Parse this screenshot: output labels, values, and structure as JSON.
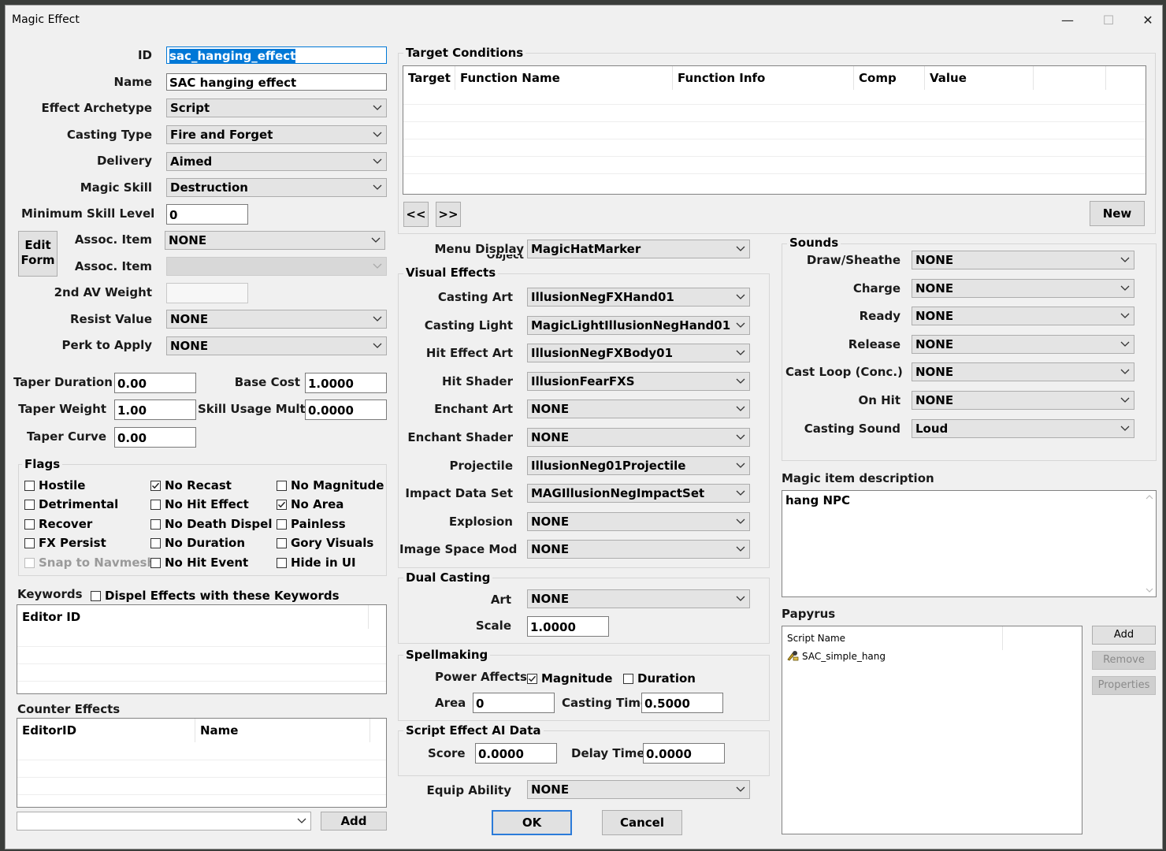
{
  "window": {
    "title": "Magic Effect",
    "minimize": "—",
    "maximize": "☐",
    "close": "✕"
  },
  "left": {
    "id_label": "ID",
    "id_value": "sac_hanging_effect",
    "name_label": "Name",
    "name_value": "SAC hanging effect",
    "archetype_label": "Effect Archetype",
    "archetype_value": "Script",
    "casting_type_label": "Casting Type",
    "casting_type_value": "Fire and Forget",
    "delivery_label": "Delivery",
    "delivery_value": "Aimed",
    "magic_skill_label": "Magic Skill",
    "magic_skill_value": "Destruction",
    "min_skill_label": "Minimum Skill Level",
    "min_skill_value": "0",
    "edit_form_label": "Edit Form",
    "assoc_item_label": "Assoc. Item",
    "assoc_item_value": "NONE",
    "assoc_item2_label": "Assoc. Item",
    "second_av_label": "2nd AV Weight",
    "second_av_value": "",
    "resist_label": "Resist Value",
    "resist_value": "NONE",
    "perk_label": "Perk to Apply",
    "perk_value": "NONE",
    "taper_duration_label": "Taper Duration",
    "taper_duration_value": "0.00",
    "base_cost_label": "Base Cost",
    "base_cost_value": "1.0000",
    "taper_weight_label": "Taper Weight",
    "taper_weight_value": "1.00",
    "skill_usage_label": "Skill Usage Mult",
    "skill_usage_value": "0.0000",
    "taper_curve_label": "Taper Curve",
    "taper_curve_value": "0.00"
  },
  "flags": {
    "label": "Flags",
    "items": [
      {
        "label": "Hostile",
        "checked": false,
        "disabled": false
      },
      {
        "label": "No Recast",
        "checked": true,
        "disabled": false
      },
      {
        "label": "No Magnitude",
        "checked": false,
        "disabled": false
      },
      {
        "label": "Detrimental",
        "checked": false,
        "disabled": false
      },
      {
        "label": "No Hit Effect",
        "checked": false,
        "disabled": false
      },
      {
        "label": "No Area",
        "checked": true,
        "disabled": false
      },
      {
        "label": "Recover",
        "checked": false,
        "disabled": false
      },
      {
        "label": "No Death Dispel",
        "checked": false,
        "disabled": false
      },
      {
        "label": "Painless",
        "checked": false,
        "disabled": false
      },
      {
        "label": "FX Persist",
        "checked": false,
        "disabled": false
      },
      {
        "label": "No Duration",
        "checked": false,
        "disabled": false
      },
      {
        "label": "Gory Visuals",
        "checked": false,
        "disabled": false
      },
      {
        "label": "Snap to Navmesh",
        "checked": false,
        "disabled": true
      },
      {
        "label": "No Hit Event",
        "checked": false,
        "disabled": false
      },
      {
        "label": "Hide in UI",
        "checked": false,
        "disabled": false
      }
    ]
  },
  "keywords": {
    "label": "Keywords",
    "dispel_label": "Dispel Effects with these Keywords",
    "column": "Editor ID"
  },
  "counter": {
    "label": "Counter Effects",
    "col1": "EditorID",
    "col2": "Name",
    "add_label": "Add",
    "combo_value": ""
  },
  "target": {
    "label": "Target Conditions",
    "columns": [
      "Target",
      "Function Name",
      "Function Info",
      "Comp",
      "Value",
      ""
    ],
    "prev": "<<",
    "next": ">>",
    "new_label": "New"
  },
  "menu_display": {
    "label": "Menu Display",
    "sublabel": "Object",
    "value": "MagicHatMarker"
  },
  "visual": {
    "label": "Visual Effects",
    "rows": [
      {
        "label": "Casting Art",
        "value": "IllusionNegFXHand01"
      },
      {
        "label": "Casting Light",
        "value": "MagicLightIllusionNegHand01"
      },
      {
        "label": "Hit Effect Art",
        "value": "IllusionNegFXBody01"
      },
      {
        "label": "Hit Shader",
        "value": "IllusionFearFXS"
      },
      {
        "label": "Enchant Art",
        "value": "NONE"
      },
      {
        "label": "Enchant Shader",
        "value": "NONE"
      },
      {
        "label": "Projectile",
        "value": "IllusionNeg01Projectile"
      },
      {
        "label": "Impact Data Set",
        "value": "MAGIllusionNegImpactSet"
      },
      {
        "label": "Explosion",
        "value": "NONE"
      },
      {
        "label": "Image Space Mod",
        "value": "NONE"
      }
    ]
  },
  "dual": {
    "label": "Dual Casting",
    "art_label": "Art",
    "art_value": "NONE",
    "scale_label": "Scale",
    "scale_value": "1.0000"
  },
  "spell": {
    "label": "Spellmaking",
    "power_label": "Power Affects",
    "magnitude_label": "Magnitude",
    "magnitude_checked": true,
    "duration_label": "Duration",
    "duration_checked": false,
    "area_label": "Area",
    "area_value": "0",
    "casting_time_label": "Casting Time",
    "casting_time_value": "0.5000"
  },
  "ai": {
    "label": "Script Effect AI Data",
    "score_label": "Score",
    "score_value": "0.0000",
    "delay_label": "Delay Time",
    "delay_value": "0.0000"
  },
  "equip": {
    "label": "Equip Ability",
    "value": "NONE"
  },
  "ok_label": "OK",
  "cancel_label": "Cancel",
  "sounds": {
    "label": "Sounds",
    "rows": [
      {
        "label": "Draw/Sheathe",
        "value": "NONE"
      },
      {
        "label": "Charge",
        "value": "NONE"
      },
      {
        "label": "Ready",
        "value": "NONE"
      },
      {
        "label": "Release",
        "value": "NONE"
      },
      {
        "label": "Cast Loop (Conc.)",
        "value": "NONE"
      },
      {
        "label": "On Hit",
        "value": "NONE"
      },
      {
        "label": "Casting Sound",
        "value": "Loud"
      }
    ]
  },
  "description": {
    "label": "Magic item description",
    "value": "hang NPC"
  },
  "papyrus": {
    "label": "Papyrus",
    "column": "Script Name",
    "scripts": [
      "SAC_simple_hang"
    ],
    "add_label": "Add",
    "remove_label": "Remove",
    "properties_label": "Properties"
  }
}
